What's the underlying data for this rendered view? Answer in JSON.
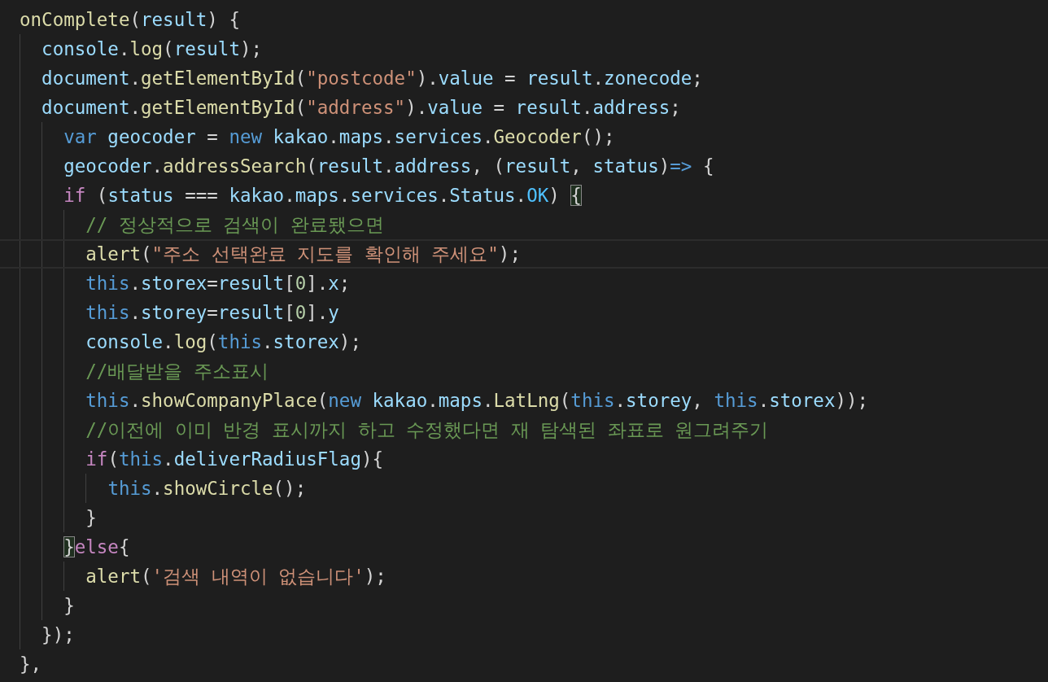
{
  "editor": {
    "lines": [
      {
        "current": false,
        "tokens": [
          {
            "kind": "fn",
            "text": "onComplete"
          },
          {
            "kind": "plain",
            "text": "("
          },
          {
            "kind": "var",
            "text": "result"
          },
          {
            "kind": "plain",
            "text": ") {"
          }
        ]
      },
      {
        "current": false,
        "tokens": [
          {
            "kind": "var",
            "text": "  console"
          },
          {
            "kind": "plain",
            "text": "."
          },
          {
            "kind": "fn",
            "text": "log"
          },
          {
            "kind": "plain",
            "text": "("
          },
          {
            "kind": "var",
            "text": "result"
          },
          {
            "kind": "plain",
            "text": ");"
          }
        ]
      },
      {
        "current": false,
        "tokens": [
          {
            "kind": "var",
            "text": "  document"
          },
          {
            "kind": "plain",
            "text": "."
          },
          {
            "kind": "fn",
            "text": "getElementById"
          },
          {
            "kind": "plain",
            "text": "("
          },
          {
            "kind": "str",
            "text": "\"postcode\""
          },
          {
            "kind": "plain",
            "text": ")."
          },
          {
            "kind": "var",
            "text": "value"
          },
          {
            "kind": "plain",
            "text": " = "
          },
          {
            "kind": "var",
            "text": "result"
          },
          {
            "kind": "plain",
            "text": "."
          },
          {
            "kind": "var",
            "text": "zonecode"
          },
          {
            "kind": "plain",
            "text": ";"
          }
        ]
      },
      {
        "current": false,
        "tokens": [
          {
            "kind": "var",
            "text": "  document"
          },
          {
            "kind": "plain",
            "text": "."
          },
          {
            "kind": "fn",
            "text": "getElementById"
          },
          {
            "kind": "plain",
            "text": "("
          },
          {
            "kind": "str",
            "text": "\"address\""
          },
          {
            "kind": "plain",
            "text": ")."
          },
          {
            "kind": "var",
            "text": "value"
          },
          {
            "kind": "plain",
            "text": " = "
          },
          {
            "kind": "var",
            "text": "result"
          },
          {
            "kind": "plain",
            "text": "."
          },
          {
            "kind": "var",
            "text": "address"
          },
          {
            "kind": "plain",
            "text": ";"
          }
        ]
      },
      {
        "current": false,
        "tokens": [
          {
            "kind": "kw",
            "text": "    var"
          },
          {
            "kind": "var",
            "text": " geocoder"
          },
          {
            "kind": "plain",
            "text": " = "
          },
          {
            "kind": "kw",
            "text": "new"
          },
          {
            "kind": "var",
            "text": " kakao"
          },
          {
            "kind": "plain",
            "text": "."
          },
          {
            "kind": "var",
            "text": "maps"
          },
          {
            "kind": "plain",
            "text": "."
          },
          {
            "kind": "var",
            "text": "services"
          },
          {
            "kind": "plain",
            "text": "."
          },
          {
            "kind": "fn",
            "text": "Geocoder"
          },
          {
            "kind": "plain",
            "text": "();"
          }
        ]
      },
      {
        "current": false,
        "tokens": [
          {
            "kind": "var",
            "text": "    geocoder"
          },
          {
            "kind": "plain",
            "text": "."
          },
          {
            "kind": "fn",
            "text": "addressSearch"
          },
          {
            "kind": "plain",
            "text": "("
          },
          {
            "kind": "var",
            "text": "result"
          },
          {
            "kind": "plain",
            "text": "."
          },
          {
            "kind": "var",
            "text": "address"
          },
          {
            "kind": "plain",
            "text": ", ("
          },
          {
            "kind": "var",
            "text": "result"
          },
          {
            "kind": "plain",
            "text": ", "
          },
          {
            "kind": "var",
            "text": "status"
          },
          {
            "kind": "plain",
            "text": ")"
          },
          {
            "kind": "kw",
            "text": "=>"
          },
          {
            "kind": "plain",
            "text": " {"
          }
        ]
      },
      {
        "current": false,
        "tokens": [
          {
            "kind": "ctrl",
            "text": "    if"
          },
          {
            "kind": "plain",
            "text": " ("
          },
          {
            "kind": "var",
            "text": "status"
          },
          {
            "kind": "plain",
            "text": " === "
          },
          {
            "kind": "var",
            "text": "kakao"
          },
          {
            "kind": "plain",
            "text": "."
          },
          {
            "kind": "var",
            "text": "maps"
          },
          {
            "kind": "plain",
            "text": "."
          },
          {
            "kind": "var",
            "text": "services"
          },
          {
            "kind": "plain",
            "text": "."
          },
          {
            "kind": "var",
            "text": "Status"
          },
          {
            "kind": "plain",
            "text": "."
          },
          {
            "kind": "const",
            "text": "OK"
          },
          {
            "kind": "plain",
            "text": ") "
          },
          {
            "kind": "plain",
            "text": "{",
            "matched": true
          }
        ]
      },
      {
        "current": false,
        "tokens": [
          {
            "kind": "cmt",
            "text": "      // 정상적으로 검색이 완료됐으면"
          }
        ]
      },
      {
        "current": true,
        "tokens": [
          {
            "kind": "fn",
            "text": "      alert"
          },
          {
            "kind": "plain",
            "text": "("
          },
          {
            "kind": "str",
            "text": "\"주소 선택완료 지도를 확인해 주세요\""
          },
          {
            "kind": "plain",
            "text": ");"
          }
        ]
      },
      {
        "current": false,
        "tokens": [
          {
            "kind": "kw",
            "text": "      this"
          },
          {
            "kind": "plain",
            "text": "."
          },
          {
            "kind": "var",
            "text": "storex"
          },
          {
            "kind": "plain",
            "text": "="
          },
          {
            "kind": "var",
            "text": "result"
          },
          {
            "kind": "plain",
            "text": "["
          },
          {
            "kind": "num",
            "text": "0"
          },
          {
            "kind": "plain",
            "text": "]."
          },
          {
            "kind": "var",
            "text": "x"
          },
          {
            "kind": "plain",
            "text": ";"
          }
        ]
      },
      {
        "current": false,
        "tokens": [
          {
            "kind": "kw",
            "text": "      this"
          },
          {
            "kind": "plain",
            "text": "."
          },
          {
            "kind": "var",
            "text": "storey"
          },
          {
            "kind": "plain",
            "text": "="
          },
          {
            "kind": "var",
            "text": "result"
          },
          {
            "kind": "plain",
            "text": "["
          },
          {
            "kind": "num",
            "text": "0"
          },
          {
            "kind": "plain",
            "text": "]."
          },
          {
            "kind": "var",
            "text": "y"
          }
        ]
      },
      {
        "current": false,
        "tokens": [
          {
            "kind": "var",
            "text": "      console"
          },
          {
            "kind": "plain",
            "text": "."
          },
          {
            "kind": "fn",
            "text": "log"
          },
          {
            "kind": "plain",
            "text": "("
          },
          {
            "kind": "kw",
            "text": "this"
          },
          {
            "kind": "plain",
            "text": "."
          },
          {
            "kind": "var",
            "text": "storex"
          },
          {
            "kind": "plain",
            "text": ");"
          }
        ]
      },
      {
        "current": false,
        "tokens": [
          {
            "kind": "cmt",
            "text": "      //배달받을 주소표시"
          }
        ]
      },
      {
        "current": false,
        "tokens": [
          {
            "kind": "kw",
            "text": "      this"
          },
          {
            "kind": "plain",
            "text": "."
          },
          {
            "kind": "fn",
            "text": "showCompanyPlace"
          },
          {
            "kind": "plain",
            "text": "("
          },
          {
            "kind": "kw",
            "text": "new"
          },
          {
            "kind": "var",
            "text": " kakao"
          },
          {
            "kind": "plain",
            "text": "."
          },
          {
            "kind": "var",
            "text": "maps"
          },
          {
            "kind": "plain",
            "text": "."
          },
          {
            "kind": "fn",
            "text": "LatLng"
          },
          {
            "kind": "plain",
            "text": "("
          },
          {
            "kind": "kw",
            "text": "this"
          },
          {
            "kind": "plain",
            "text": "."
          },
          {
            "kind": "var",
            "text": "storey"
          },
          {
            "kind": "plain",
            "text": ", "
          },
          {
            "kind": "kw",
            "text": "this"
          },
          {
            "kind": "plain",
            "text": "."
          },
          {
            "kind": "var",
            "text": "storex"
          },
          {
            "kind": "plain",
            "text": "));"
          }
        ]
      },
      {
        "current": false,
        "tokens": [
          {
            "kind": "cmt",
            "text": "      //이전에 이미 반경 표시까지 하고 수정했다면 재 탐색된 좌표로 원그려주기"
          }
        ]
      },
      {
        "current": false,
        "tokens": [
          {
            "kind": "ctrl",
            "text": "      if"
          },
          {
            "kind": "plain",
            "text": "("
          },
          {
            "kind": "kw",
            "text": "this"
          },
          {
            "kind": "plain",
            "text": "."
          },
          {
            "kind": "var",
            "text": "deliverRadiusFlag"
          },
          {
            "kind": "plain",
            "text": "){"
          }
        ]
      },
      {
        "current": false,
        "tokens": [
          {
            "kind": "kw",
            "text": "        this"
          },
          {
            "kind": "method",
            "text": ".showCircle"
          },
          {
            "kind": "plain",
            "text": "();"
          }
        ]
      },
      {
        "current": false,
        "tokens": [
          {
            "kind": "plain",
            "text": "      }"
          }
        ]
      },
      {
        "current": false,
        "tokens": [
          {
            "kind": "plain",
            "text": "    }",
            "matched": true
          },
          {
            "kind": "ctrl",
            "text": "else"
          },
          {
            "kind": "plain",
            "text": "{"
          }
        ]
      },
      {
        "current": false,
        "tokens": [
          {
            "kind": "fn",
            "text": "      alert"
          },
          {
            "kind": "plain",
            "text": "("
          },
          {
            "kind": "str",
            "text": "'검색 내역이 없습니다'"
          },
          {
            "kind": "plain",
            "text": ");"
          }
        ]
      },
      {
        "current": false,
        "tokens": [
          {
            "kind": "plain",
            "text": "    }"
          }
        ]
      },
      {
        "current": false,
        "tokens": [
          {
            "kind": "plain",
            "text": "  });"
          }
        ]
      },
      {
        "current": false,
        "tokens": [
          {
            "kind": "plain",
            "text": "},"
          }
        ]
      }
    ]
  }
}
